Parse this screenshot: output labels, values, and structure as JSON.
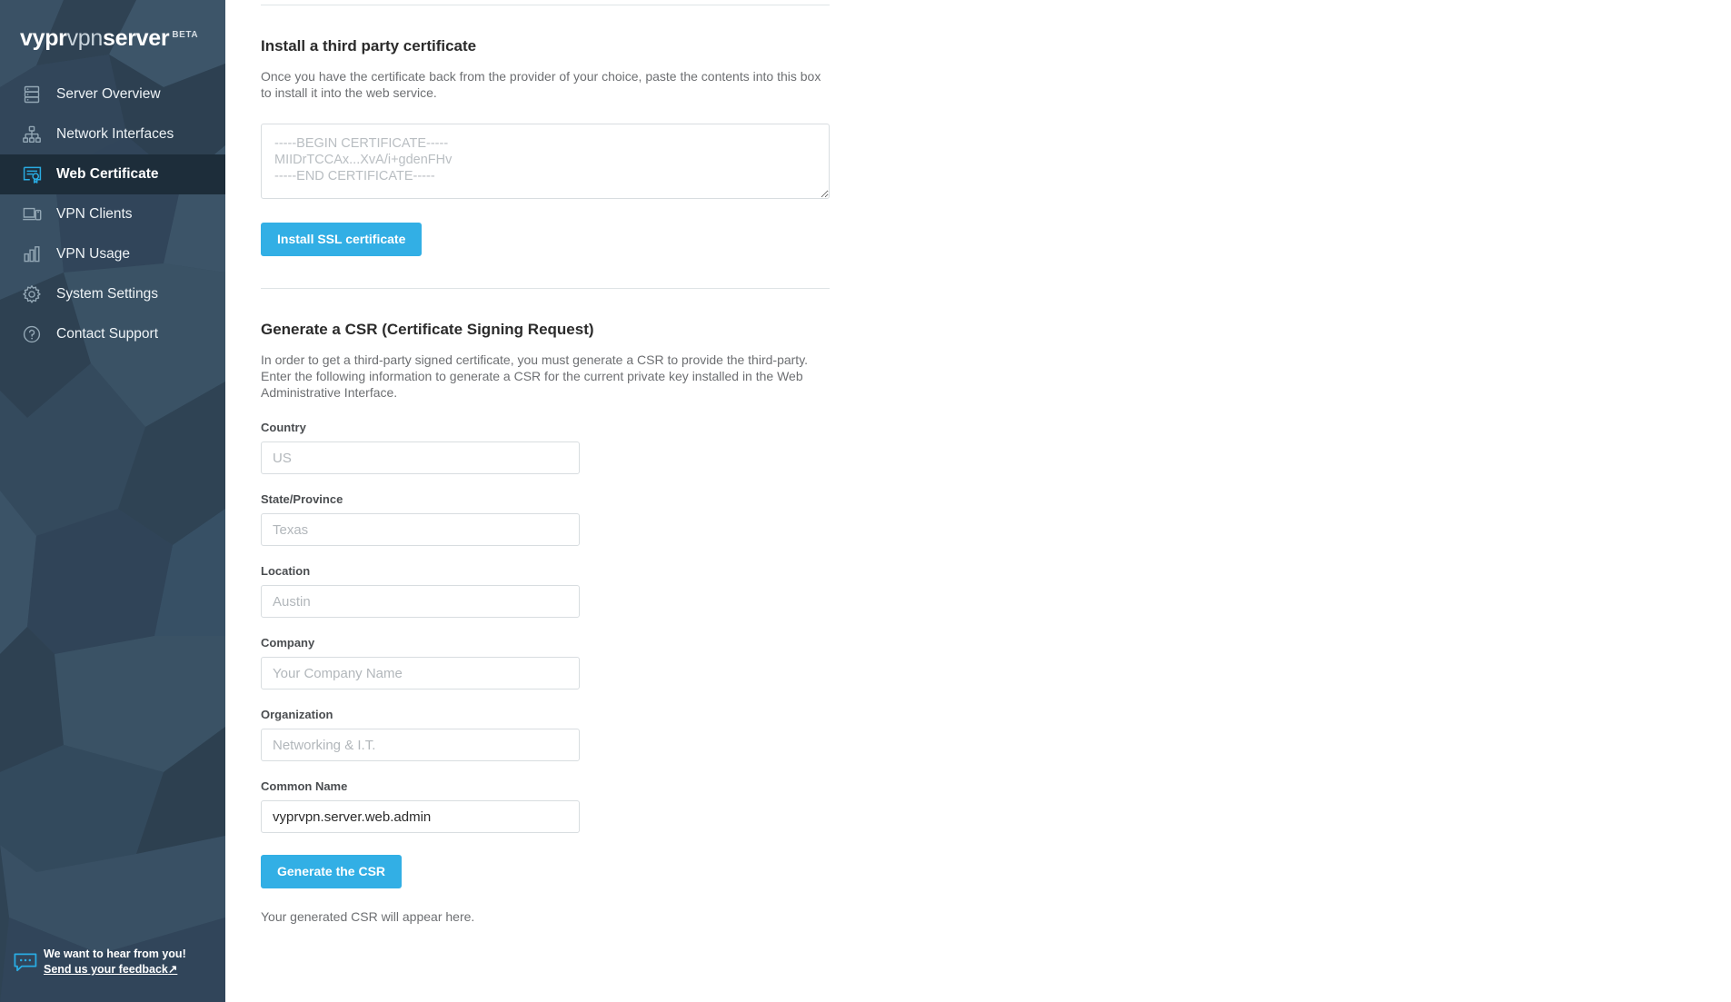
{
  "brand": {
    "name_part1": "vypr",
    "name_part2": "vpn",
    "name_part3": "server",
    "badge": "BETA"
  },
  "sidebar": {
    "items": [
      {
        "label": "Server Overview",
        "icon": "server-icon",
        "active": false
      },
      {
        "label": "Network Interfaces",
        "icon": "network-tree-icon",
        "active": false
      },
      {
        "label": "Web Certificate",
        "icon": "certificate-icon",
        "active": true
      },
      {
        "label": "VPN Clients",
        "icon": "devices-icon",
        "active": false
      },
      {
        "label": "VPN Usage",
        "icon": "bar-chart-icon",
        "active": false
      },
      {
        "label": "System Settings",
        "icon": "gear-icon",
        "active": false
      },
      {
        "label": "Contact Support",
        "icon": "question-circle-icon",
        "active": false
      }
    ],
    "feedback": {
      "icon": "speech-bubble-icon",
      "line1": "We want to hear from you!",
      "link": "Send us your feedback",
      "link_arrow": "↗"
    }
  },
  "install_section": {
    "title": "Install a third party certificate",
    "description": "Once you have the certificate back from the provider of your choice, paste the contents into this box to install it into the web service.",
    "textarea": {
      "value": "",
      "placeholder": "-----BEGIN CERTIFICATE-----\nMIIDrTCCAx...XvA/i+gdenFHv\n-----END CERTIFICATE-----"
    },
    "button_label": "Install SSL certificate"
  },
  "csr_section": {
    "title": "Generate a CSR (Certificate Signing Request)",
    "description": "In order to get a third-party signed certificate, you must generate a CSR to provide the third-party. Enter the following information to generate a CSR for the current private key installed in the Web Administrative Interface.",
    "fields": [
      {
        "label": "Country",
        "value": "",
        "placeholder": "US"
      },
      {
        "label": "State/Province",
        "value": "",
        "placeholder": "Texas"
      },
      {
        "label": "Location",
        "value": "",
        "placeholder": "Austin"
      },
      {
        "label": "Company",
        "value": "",
        "placeholder": "Your Company Name"
      },
      {
        "label": "Organization",
        "value": "",
        "placeholder": "Networking & I.T."
      },
      {
        "label": "Common Name",
        "value": "vyprvpn.server.web.admin",
        "placeholder": ""
      }
    ],
    "button_label": "Generate the CSR",
    "result_text": "Your generated CSR will appear here."
  },
  "colors": {
    "accent": "#32afe5",
    "sidebar_bg": "#35495b",
    "sidebar_active_bg": "#1d2d3a",
    "divider": "#dfe4e6",
    "text_muted": "#6d6f72"
  }
}
